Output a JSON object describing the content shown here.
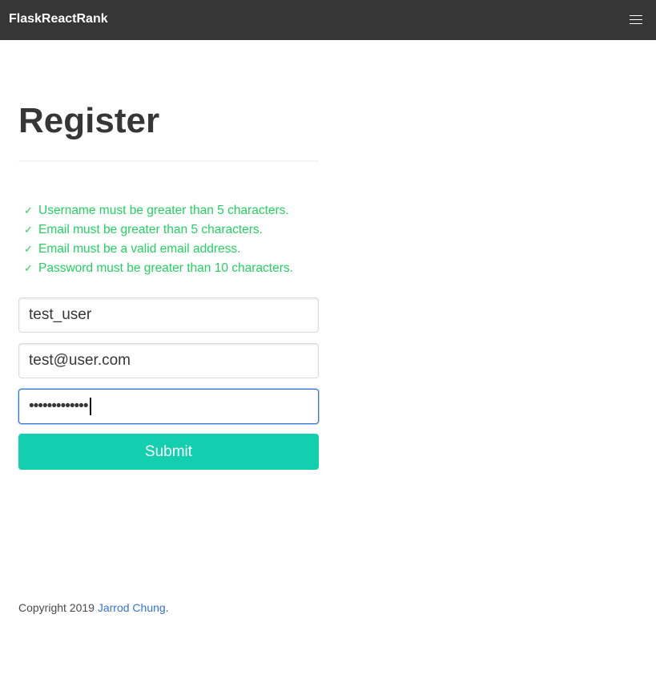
{
  "navbar": {
    "brand": "FlaskReactRank",
    "menu_icon": "hamburger-menu-icon"
  },
  "page": {
    "title": "Register"
  },
  "validation": {
    "check_icon": "✓",
    "color": "#23d160",
    "rules": [
      "Username must be greater than 5 characters.",
      "Email must be greater than 5 characters.",
      "Email must be a valid email address.",
      "Password must be greater than 10 characters."
    ]
  },
  "form": {
    "username_value": "test_user",
    "email_value": "test@user.com",
    "password_masked": "•••••••••••••",
    "submit_label": "Submit",
    "submit_color": "#13cfb0",
    "focus_color": "#3273dc"
  },
  "footer": {
    "copyright_text": "Copyright 2019 ",
    "author_link": "Jarrod Chung",
    "trailing": "."
  }
}
